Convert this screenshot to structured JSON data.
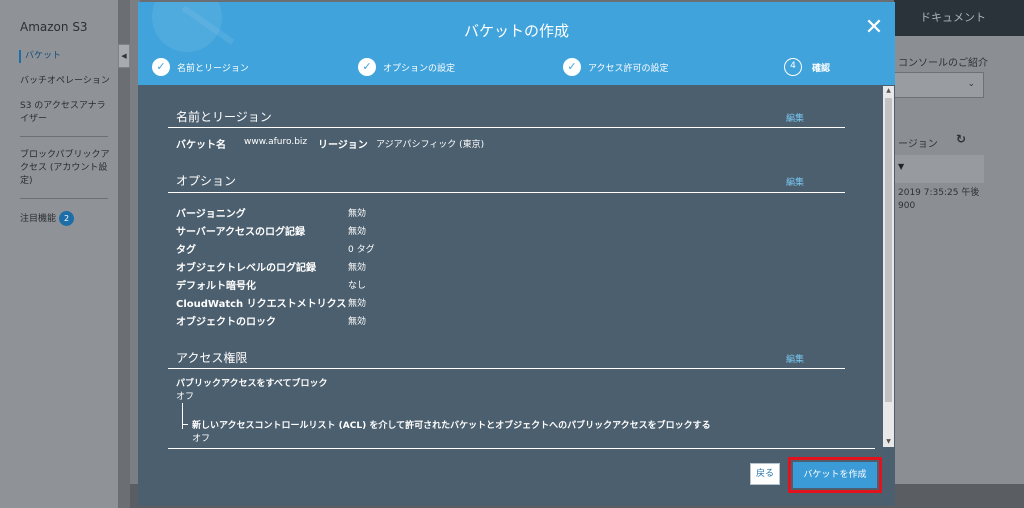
{
  "sidebar": {
    "app_title": "Amazon S3",
    "items": [
      {
        "label": "バケット"
      },
      {
        "label": "バッチオペレーション"
      },
      {
        "label": "S3 のアクセスアナライザー"
      },
      {
        "label": "ブロックパブリックアクセス (アカウント設定)"
      },
      {
        "label": "注目機能",
        "badge": "2"
      }
    ]
  },
  "right_panel": {
    "doc_link": "ドキュメント",
    "intro": "コンソールのご紹介",
    "region_label": "ージョン",
    "date_line1": "2019 7:35:25 午後",
    "date_line2": "900"
  },
  "modal": {
    "title": "バケットの作成",
    "steps": [
      {
        "label": "名前とリージョン",
        "done": true
      },
      {
        "label": "オプションの設定",
        "done": true
      },
      {
        "label": "アクセス許可の設定",
        "done": true
      },
      {
        "number": "4",
        "label": "確認",
        "done": false
      }
    ],
    "edit_label": "編集",
    "section_name": {
      "title": "名前とリージョン",
      "bucket_label": "バケット名",
      "bucket_value": "www.afuro.biz",
      "region_label": "リージョン",
      "region_value": "アジアパシフィック (東京)"
    },
    "section_options": {
      "title": "オプション",
      "rows": [
        {
          "label": "バージョニング",
          "value": "無効"
        },
        {
          "label": "サーバーアクセスのログ記録",
          "value": "無効"
        },
        {
          "label": "タグ",
          "value": "0 タグ"
        },
        {
          "label": "オブジェクトレベルのログ記録",
          "value": "無効"
        },
        {
          "label": "デフォルト暗号化",
          "value": "なし"
        },
        {
          "label": "CloudWatch リクエストメトリクス",
          "value": "無効"
        },
        {
          "label": "オブジェクトのロック",
          "value": "無効"
        }
      ]
    },
    "section_access": {
      "title": "アクセス権限",
      "block_all_label": "パブリックアクセスをすべてブロック",
      "block_all_value": "オフ",
      "acl_label": "新しいアクセスコントロールリスト (ACL) を介して許可されたバケットとオブジェクトへのパブリックアクセスをブロックする",
      "acl_value": "オフ"
    },
    "back_label": "戻る",
    "create_label": "バケットを作成"
  },
  "colors": {
    "header": "#41a3dc",
    "body": "#4c5f6e",
    "link": "#79c7f1",
    "primary_button": "#3a9bd7",
    "highlight": "#e1141d"
  }
}
